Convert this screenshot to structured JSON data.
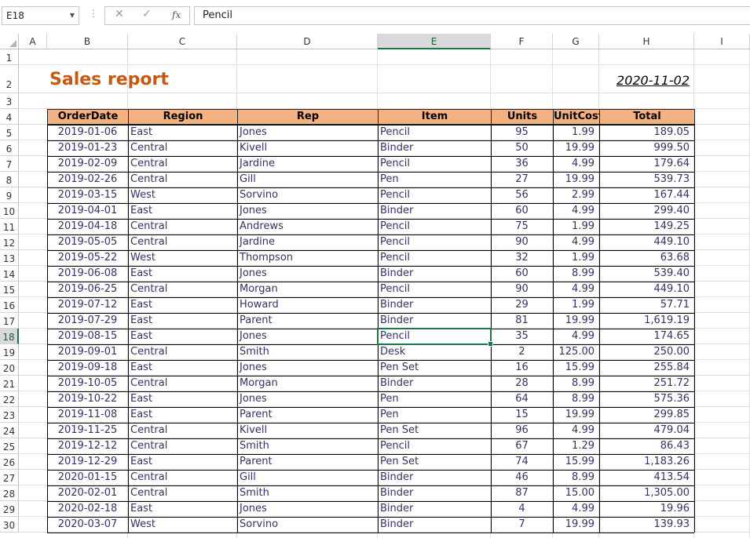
{
  "formula_bar": {
    "name_box": "E18",
    "formula": "Pencil",
    "cancel_icon": "✕",
    "enter_icon": "✓",
    "fx_icon": "fx"
  },
  "columns": [
    "A",
    "B",
    "C",
    "D",
    "E",
    "F",
    "G",
    "H",
    "I"
  ],
  "selected_column": "E",
  "selected_row": "18",
  "row_numbers": [
    "1",
    "2",
    "3",
    "4",
    "5",
    "6",
    "7",
    "8",
    "9",
    "10",
    "11",
    "12",
    "13",
    "14",
    "15",
    "16",
    "17",
    "18",
    "19",
    "20",
    "21",
    "22",
    "23",
    "24",
    "25",
    "26",
    "27",
    "28",
    "29",
    "30"
  ],
  "report": {
    "title": "Sales report",
    "date": "2020-11-02"
  },
  "table": {
    "headers": [
      "OrderDate",
      "Region",
      "Rep",
      "Item",
      "Units",
      "UnitCost",
      "Total"
    ],
    "rows": [
      [
        "2019-01-06",
        "East",
        "Jones",
        "Pencil",
        "95",
        "1.99",
        "189.05"
      ],
      [
        "2019-01-23",
        "Central",
        "Kivell",
        "Binder",
        "50",
        "19.99",
        "999.50"
      ],
      [
        "2019-02-09",
        "Central",
        "Jardine",
        "Pencil",
        "36",
        "4.99",
        "179.64"
      ],
      [
        "2019-02-26",
        "Central",
        "Gill",
        "Pen",
        "27",
        "19.99",
        "539.73"
      ],
      [
        "2019-03-15",
        "West",
        "Sorvino",
        "Pencil",
        "56",
        "2.99",
        "167.44"
      ],
      [
        "2019-04-01",
        "East",
        "Jones",
        "Binder",
        "60",
        "4.99",
        "299.40"
      ],
      [
        "2019-04-18",
        "Central",
        "Andrews",
        "Pencil",
        "75",
        "1.99",
        "149.25"
      ],
      [
        "2019-05-05",
        "Central",
        "Jardine",
        "Pencil",
        "90",
        "4.99",
        "449.10"
      ],
      [
        "2019-05-22",
        "West",
        "Thompson",
        "Pencil",
        "32",
        "1.99",
        "63.68"
      ],
      [
        "2019-06-08",
        "East",
        "Jones",
        "Binder",
        "60",
        "8.99",
        "539.40"
      ],
      [
        "2019-06-25",
        "Central",
        "Morgan",
        "Pencil",
        "90",
        "4.99",
        "449.10"
      ],
      [
        "2019-07-12",
        "East",
        "Howard",
        "Binder",
        "29",
        "1.99",
        "57.71"
      ],
      [
        "2019-07-29",
        "East",
        "Parent",
        "Binder",
        "81",
        "19.99",
        "1,619.19"
      ],
      [
        "2019-08-15",
        "East",
        "Jones",
        "Pencil",
        "35",
        "4.99",
        "174.65"
      ],
      [
        "2019-09-01",
        "Central",
        "Smith",
        "Desk",
        "2",
        "125.00",
        "250.00"
      ],
      [
        "2019-09-18",
        "East",
        "Jones",
        "Pen Set",
        "16",
        "15.99",
        "255.84"
      ],
      [
        "2019-10-05",
        "Central",
        "Morgan",
        "Binder",
        "28",
        "8.99",
        "251.72"
      ],
      [
        "2019-10-22",
        "East",
        "Jones",
        "Pen",
        "64",
        "8.99",
        "575.36"
      ],
      [
        "2019-11-08",
        "East",
        "Parent",
        "Pen",
        "15",
        "19.99",
        "299.85"
      ],
      [
        "2019-11-25",
        "Central",
        "Kivell",
        "Pen Set",
        "96",
        "4.99",
        "479.04"
      ],
      [
        "2019-12-12",
        "Central",
        "Smith",
        "Pencil",
        "67",
        "1.29",
        "86.43"
      ],
      [
        "2019-12-29",
        "East",
        "Parent",
        "Pen Set",
        "74",
        "15.99",
        "1,183.26"
      ],
      [
        "2020-01-15",
        "Central",
        "Gill",
        "Binder",
        "46",
        "8.99",
        "413.54"
      ],
      [
        "2020-02-01",
        "Central",
        "Smith",
        "Binder",
        "87",
        "15.00",
        "1,305.00"
      ],
      [
        "2020-02-18",
        "East",
        "Jones",
        "Binder",
        "4",
        "4.99",
        "19.96"
      ],
      [
        "2020-03-07",
        "West",
        "Sorvino",
        "Binder",
        "7",
        "19.99",
        "139.93"
      ]
    ]
  },
  "colors": {
    "title": "#c65911",
    "header_fill": "#f4b183",
    "selection": "#217346"
  }
}
